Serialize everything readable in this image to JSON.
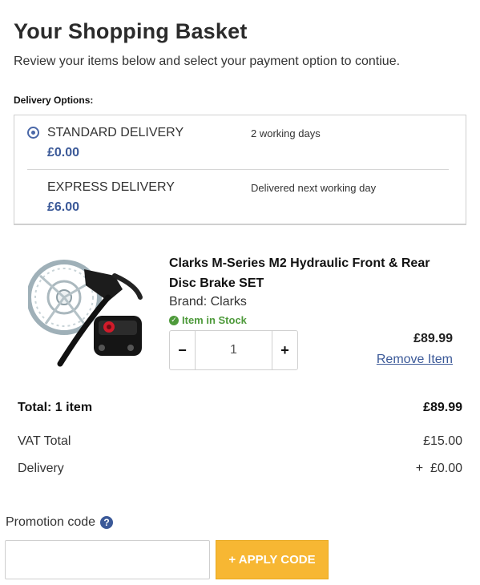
{
  "header": {
    "title": "Your Shopping Basket",
    "subtitle": "Review your items below and select your payment option to contiue."
  },
  "delivery": {
    "heading": "Delivery Options:",
    "options": [
      {
        "name": "STANDARD DELIVERY",
        "price": "£0.00",
        "time": "2 working days",
        "selected": true
      },
      {
        "name": "EXPRESS DELIVERY",
        "price": "£6.00",
        "time": "Delivered next working day",
        "selected": false
      }
    ]
  },
  "item": {
    "name": "Clarks M-Series M2 Hydraulic Front & Rear Disc Brake SET",
    "brand": "Brand: Clarks",
    "stock": "Item in Stock",
    "quantity": "1",
    "minus": "−",
    "plus": "+",
    "price": "£89.99",
    "remove": "Remove Item"
  },
  "summary": {
    "total_label": "Total: 1 item",
    "total_value": "£89.99",
    "vat_label": "VAT Total",
    "vat_value": "£15.00",
    "delivery_label": "Delivery",
    "delivery_value": "+  £0.00"
  },
  "promo": {
    "label": "Promotion code",
    "value": "",
    "button": "+ APPLY CODE"
  },
  "colors": {
    "accent": "#3b5998",
    "stock": "#4e9a3b",
    "apply_button": "#f7b733"
  }
}
